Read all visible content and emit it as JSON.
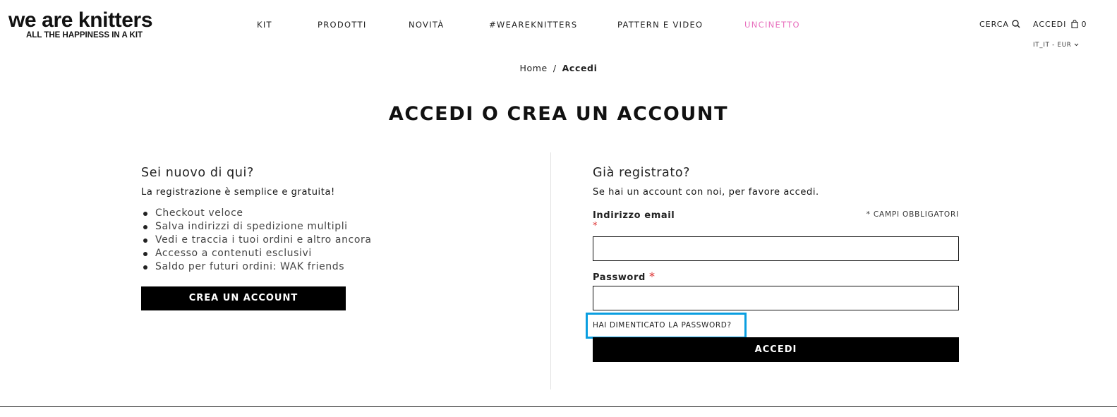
{
  "logo": {
    "main": "we are knitters",
    "tagline": "ALL THE HAPPINESS IN A KIT"
  },
  "nav": [
    {
      "label": "KIT"
    },
    {
      "label": "PRODOTTI"
    },
    {
      "label": "NOVITÀ"
    },
    {
      "label": "#WEAREKNITTERS"
    },
    {
      "label": "PATTERN E VIDEO"
    },
    {
      "label": "UNCINETTO"
    }
  ],
  "nav_highlight_color": "#e86fbd",
  "header": {
    "search_label": "CERCA",
    "login_label": "ACCEDI",
    "cart_count": "0",
    "locale": "IT_IT - EUR"
  },
  "breadcrumb": {
    "home": "Home",
    "separator": "/",
    "current": "Accedi"
  },
  "page_title": "ACCEDI O CREA UN ACCOUNT",
  "new_customer": {
    "title": "Sei nuovo di qui?",
    "subtitle": "La registrazione è semplice e gratuita!",
    "benefits": [
      "Checkout veloce",
      "Salva indirizzi di spedizione multipli",
      "Vedi e traccia i tuoi ordini e altro ancora",
      "Accesso a contenuti esclusivi",
      "Saldo per futuri ordini: WAK friends"
    ],
    "create_button": "CREA UN ACCOUNT"
  },
  "login": {
    "title": "Già registrato?",
    "subtitle": "Se hai un account con noi, per favore accedi.",
    "email_label": "Indirizzo email",
    "required_marker": "*",
    "required_note": "* CAMPI OBBLIGATORI",
    "email_value": "",
    "password_label": "Password",
    "password_value": "",
    "forgot_link": "HAI DIMENTICATO LA PASSWORD?",
    "submit_button": "ACCEDI"
  },
  "highlight_color": "#0a9ee0"
}
